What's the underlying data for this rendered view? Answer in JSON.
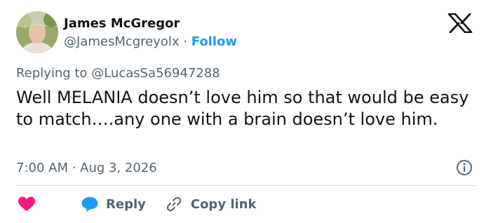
{
  "user": {
    "display_name": "James McGregor",
    "handle": "@JamesMcgreyolx",
    "separator": " · ",
    "follow_label": "Follow"
  },
  "tweet": {
    "replying_to_prefix": "Replying to ",
    "replying_to_handle": "@LucasSa56947288",
    "text": "Well MELANIA doesn’t love him so that would be easy to match….any one with a brain doesn’t love him.",
    "time": "7:00 AM",
    "date_separator": " · ",
    "date": "Aug 3, 2026"
  },
  "actions": {
    "reply_label": "Reply",
    "copy_link_label": "Copy link"
  },
  "icons": {
    "logo": "x-logo-icon",
    "like": "heart-icon",
    "reply": "speech-bubble-icon",
    "copy_link": "link-icon",
    "info": "info-icon"
  },
  "colors": {
    "follow": "#1d9bf0",
    "heart": "#f91880",
    "reply_bubble": "#1d9bf0",
    "muted_text": "#536471",
    "body_text": "#0f1419"
  }
}
